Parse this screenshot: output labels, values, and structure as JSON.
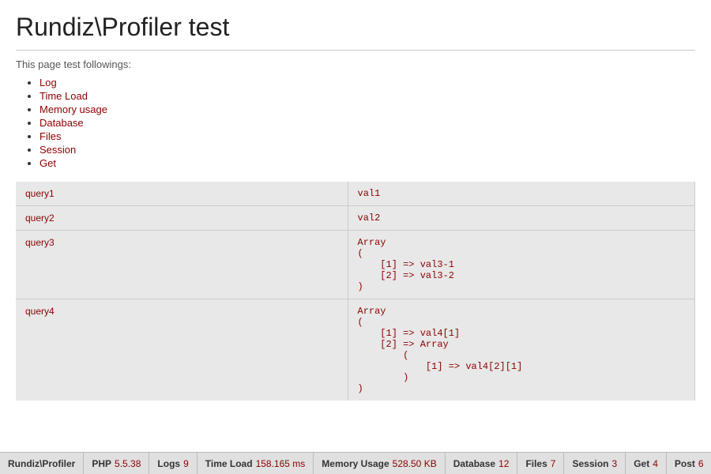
{
  "page": {
    "title": "Rundiz\\Profiler test",
    "intro": "This page test followings:",
    "list_items": [
      {
        "label": "Log",
        "href": "#"
      },
      {
        "label": "Time Load",
        "href": "#"
      },
      {
        "label": "Memory usage",
        "href": "#"
      },
      {
        "label": "Database",
        "href": "#"
      },
      {
        "label": "Files",
        "href": "#"
      },
      {
        "label": "Session",
        "href": "#"
      },
      {
        "label": "Get",
        "href": "#"
      }
    ]
  },
  "table": {
    "rows": [
      {
        "query": "query1",
        "value": "val1"
      },
      {
        "query": "query2",
        "value": "val2"
      },
      {
        "query": "query3",
        "value": "Array\n(\n    [1] => val3-1\n    [2] => val3-2\n)"
      },
      {
        "query": "query4",
        "value": "Array\n(\n    [1] => val4[1]\n    [2] => Array\n        (\n            [1] => val4[2][1]\n        )\n)"
      }
    ]
  },
  "bottom_bar": {
    "tabs": [
      {
        "name": "Rundiz\\Profiler",
        "value": ""
      },
      {
        "name": "PHP",
        "value": "5.5.38"
      },
      {
        "name": "Logs",
        "value": "9"
      },
      {
        "name": "Time Load",
        "value": "158.165 ms"
      },
      {
        "name": "Memory Usage",
        "value": "528.50 KB"
      },
      {
        "name": "Database",
        "value": "12"
      },
      {
        "name": "Files",
        "value": "7"
      },
      {
        "name": "Session",
        "value": "3"
      },
      {
        "name": "Get",
        "value": "4"
      },
      {
        "name": "Post",
        "value": "6"
      }
    ]
  }
}
